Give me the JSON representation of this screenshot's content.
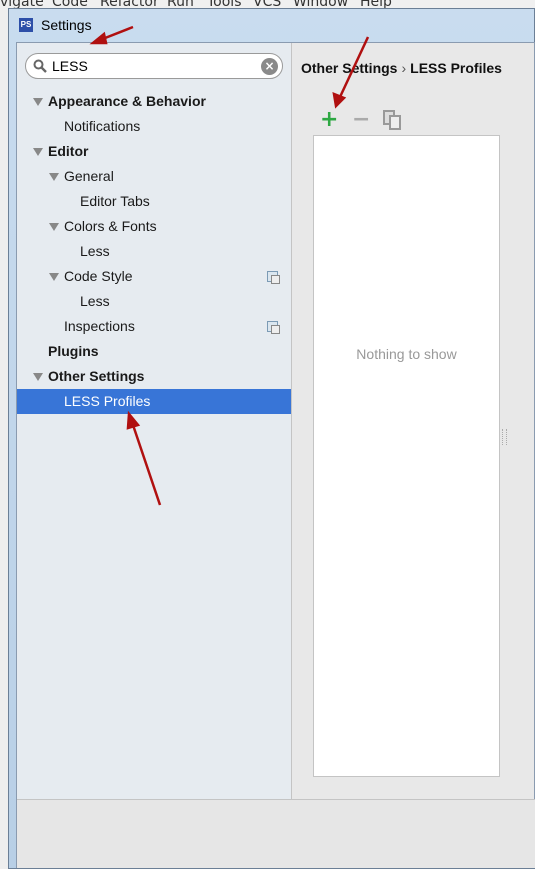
{
  "background_menu": [
    "vigate",
    "Code",
    "Refactor",
    "Run",
    "Tools",
    "VCS",
    "Window",
    "Help"
  ],
  "dialog": {
    "title": "Settings",
    "app_icon": "phpstorm-icon"
  },
  "search": {
    "value": "LESS",
    "icon": "search-icon",
    "clear_icon": "clear-icon"
  },
  "tree": [
    {
      "label": "Appearance & Behavior",
      "level": 0,
      "bold": true,
      "expanded": true
    },
    {
      "label": "Notifications",
      "level": 1
    },
    {
      "label": "Editor",
      "level": 0,
      "bold": true,
      "expanded": true
    },
    {
      "label": "General",
      "level": 1,
      "expanded": true
    },
    {
      "label": "Editor Tabs",
      "level": 2
    },
    {
      "label": "Colors & Fonts",
      "level": 1,
      "expanded": true
    },
    {
      "label": "Less",
      "level": 2
    },
    {
      "label": "Code Style",
      "level": 1,
      "expanded": true,
      "project_icon": true
    },
    {
      "label": "Less",
      "level": 2
    },
    {
      "label": "Inspections",
      "level": 1,
      "project_icon": true
    },
    {
      "label": "Plugins",
      "level": 0,
      "bold": true
    },
    {
      "label": "Other Settings",
      "level": 0,
      "bold": true,
      "expanded": true
    },
    {
      "label": "LESS Profiles",
      "level": 1,
      "selected": true
    }
  ],
  "breadcrumb": {
    "parent": "Other Settings",
    "separator": "›",
    "current": "LESS Profiles"
  },
  "toolbar": {
    "add": "+",
    "remove": "−",
    "copy_icon": "copy-icon"
  },
  "list": {
    "empty_text": "Nothing to show"
  },
  "colors": {
    "selection": "#3875d7",
    "add": "#2ea843",
    "annotation_arrow": "#b01010"
  }
}
